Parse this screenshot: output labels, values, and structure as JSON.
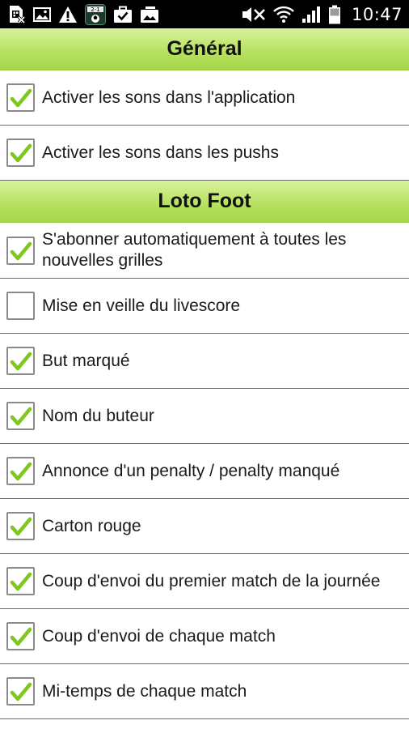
{
  "status_bar": {
    "time": "10:47",
    "left_icons": [
      "sim-card-icon",
      "image-icon",
      "warning-icon",
      "score-app-icon",
      "briefcase-check-icon",
      "gallery-icon"
    ],
    "right_icons": [
      "mute-icon",
      "wifi-icon",
      "signal-icon",
      "battery-icon"
    ]
  },
  "sections": [
    {
      "title": "Général",
      "items": [
        {
          "label": "Activer les sons dans l'application",
          "checked": true
        },
        {
          "label": "Activer les sons dans les pushs",
          "checked": true
        }
      ]
    },
    {
      "title": "Loto Foot",
      "items": [
        {
          "label": "S'abonner automatiquement à toutes les nouvelles grilles",
          "checked": true
        },
        {
          "label": "Mise en veille du livescore",
          "checked": false
        },
        {
          "label": "But marqué",
          "checked": true
        },
        {
          "label": "Nom du buteur",
          "checked": true
        },
        {
          "label": "Annonce d'un penalty / penalty manqué",
          "checked": true
        },
        {
          "label": "Carton rouge",
          "checked": true
        },
        {
          "label": "Coup d'envoi du premier match de la journée",
          "checked": true
        },
        {
          "label": "Coup d'envoi de chaque match",
          "checked": true
        },
        {
          "label": "Mi-temps de chaque match",
          "checked": true
        }
      ]
    }
  ],
  "colors": {
    "header_gradient_top": "#d9f29a",
    "header_gradient_bottom": "#a5d64a",
    "check_green": "#7cc81e",
    "divider": "#6e6e6e"
  }
}
